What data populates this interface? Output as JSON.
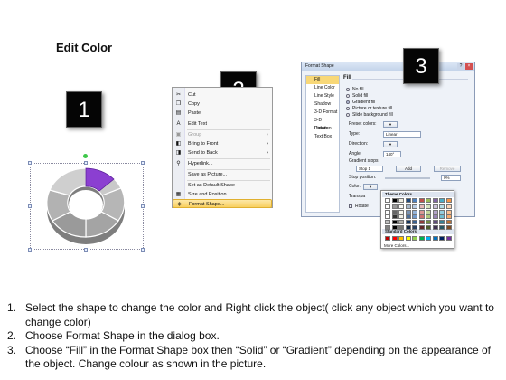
{
  "title": "Edit Color",
  "steps": [
    "1",
    "2",
    "3"
  ],
  "context_menu": {
    "items": [
      {
        "icon": "cut-icon",
        "glyph": "✂",
        "label": "Cut",
        "arrow": ""
      },
      {
        "icon": "copy-icon",
        "glyph": "❐",
        "label": "Copy",
        "arrow": ""
      },
      {
        "icon": "paste-icon",
        "glyph": "▤",
        "label": "Paste",
        "arrow": ""
      },
      {
        "icon": "edit-text-icon",
        "glyph": "A",
        "label": "Edit Text",
        "arrow": ""
      },
      {
        "icon": "group-icon",
        "glyph": "▣",
        "label": "Group",
        "arrow": "›"
      },
      {
        "icon": "bring-front-icon",
        "glyph": "◧",
        "label": "Bring to Front",
        "arrow": "›"
      },
      {
        "icon": "send-back-icon",
        "glyph": "◨",
        "label": "Send to Back",
        "arrow": "›"
      },
      {
        "icon": "hyperlink-icon",
        "glyph": "⚲",
        "label": "Hyperlink...",
        "arrow": ""
      },
      {
        "icon": "",
        "glyph": "",
        "label": "Save as Picture...",
        "arrow": ""
      },
      {
        "icon": "",
        "glyph": "",
        "label": "Set as Default Shape",
        "arrow": ""
      },
      {
        "icon": "size-position-icon",
        "glyph": "▦",
        "label": "Size and Position...",
        "arrow": ""
      },
      {
        "icon": "format-shape-icon",
        "glyph": "◈",
        "label": "Format Shape...",
        "arrow": ""
      }
    ]
  },
  "dialog": {
    "title": "Format Shape",
    "nav": [
      "Fill",
      "Line Color",
      "Line Style",
      "Shadow",
      "3-D Format",
      "3-D Rotation",
      "Picture",
      "Text Box"
    ],
    "section": "Fill",
    "fill_options": [
      "No fill",
      "Solid fill",
      "Gradient fill",
      "Picture or texture fill",
      "Slide background fill"
    ],
    "preset_colors": "Preset colors:",
    "type_label": "Type:",
    "type_value": "Linear",
    "direction_label": "Direction:",
    "angle_label": "Angle:",
    "angle_value": "140°",
    "gradient_stops": "Gradient stops",
    "stop_value": "Stop 1",
    "add_btn": "Add",
    "remove_btn": "Remove",
    "stop_position": "Stop position:",
    "stop_position_value": "0%",
    "color_label": "Color:",
    "transparency_label": "Transpa",
    "rotate_label": "Rotate",
    "close_glyph": "×"
  },
  "palette": {
    "theme_colors": "Theme Colors",
    "standard_colors": "Standard Colors",
    "more_colors": "More Colors...",
    "theme_top": [
      "#ffffff",
      "#000000",
      "#eeece1",
      "#1f497d",
      "#4f81bd",
      "#c0504d",
      "#9bbb59",
      "#8064a2",
      "#4bacc6",
      "#f79646"
    ],
    "standard": [
      "#c00000",
      "#ff0000",
      "#ffc000",
      "#ffff00",
      "#92d050",
      "#00b050",
      "#00b0f0",
      "#0070c0",
      "#002060",
      "#7030a0"
    ]
  },
  "instructions": [
    "Select the shape to change the color and Right click the object( click any object which you want to change color)",
    "Choose Format Shape in the dialog box.",
    "Choose “Fill” in the Format Shape box then “Solid” or “Gradient” depending on the appearance of the object. Change colour as shown in the picture."
  ],
  "instruction_numbers": [
    "1.",
    "2.",
    "3."
  ],
  "colors": {
    "highlight_segment": "#8b3fd1",
    "donut": "#a8a8a8",
    "menu_highlight": "#f8cf60"
  }
}
